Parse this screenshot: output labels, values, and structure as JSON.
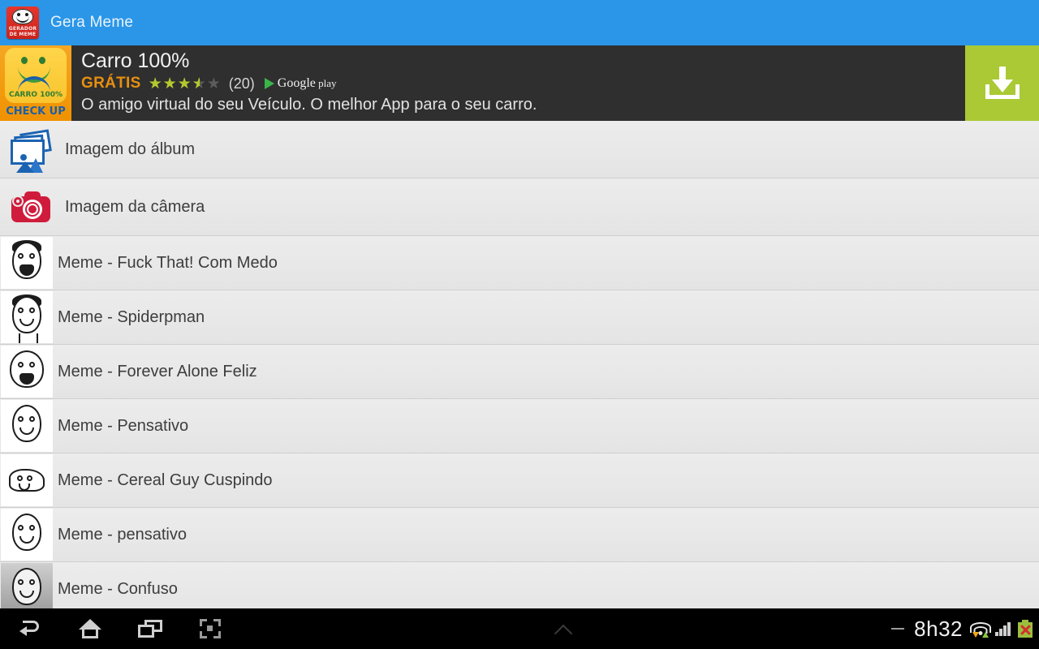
{
  "titlebar": {
    "app_name": "Gera Meme",
    "icon_caption_line1": "GERADOR",
    "icon_caption_line2": "DE MEME"
  },
  "ad": {
    "icon_brand": "CARRO 100%",
    "icon_checkup": "CHECK UP",
    "title": "Carro 100%",
    "price_label": "GRÁTIS",
    "stars_empty": "★★★★★",
    "stars_filled": "★★★★★",
    "rating_value": 3.5,
    "review_count": "(20)",
    "store_name": "Google",
    "store_suffix": " play",
    "description": "O amigo virtual do seu Veículo. O melhor App para o seu carro.",
    "cta_icon": "download-icon",
    "cta_color": "#aac934"
  },
  "list": {
    "sources": [
      {
        "label": "Imagem do álbum",
        "icon": "album-icon",
        "color": "#1b63b2"
      },
      {
        "label": "Imagem da câmera",
        "icon": "camera-icon",
        "color": "#d01c3c"
      }
    ],
    "memes": [
      {
        "label": "Meme - Fuck That! Com Medo",
        "thumb": "rage-face-fuck-that"
      },
      {
        "label": "Meme - Spiderpman",
        "thumb": "rage-face-spiderman"
      },
      {
        "label": "Meme - Forever Alone Feliz",
        "thumb": "rage-face-forever-alone"
      },
      {
        "label": "Meme - Pensativo",
        "thumb": "rage-face-pensativo"
      },
      {
        "label": "Meme - Cereal Guy Cuspindo",
        "thumb": "rage-face-cereal-guy"
      },
      {
        "label": "Meme - pensativo",
        "thumb": "rage-face-pensativo-2"
      },
      {
        "label": "Meme - Confuso",
        "thumb": "rage-face-confuso"
      }
    ]
  },
  "navbar": {
    "back": "back-icon",
    "home": "home-icon",
    "recents": "recent-apps-icon",
    "screenshot": "screenshot-icon",
    "expand": "chevron-up-icon",
    "clock": "8h32",
    "wifi": "wifi-icon",
    "signal": "signal-icon",
    "battery": "battery-error-icon"
  }
}
